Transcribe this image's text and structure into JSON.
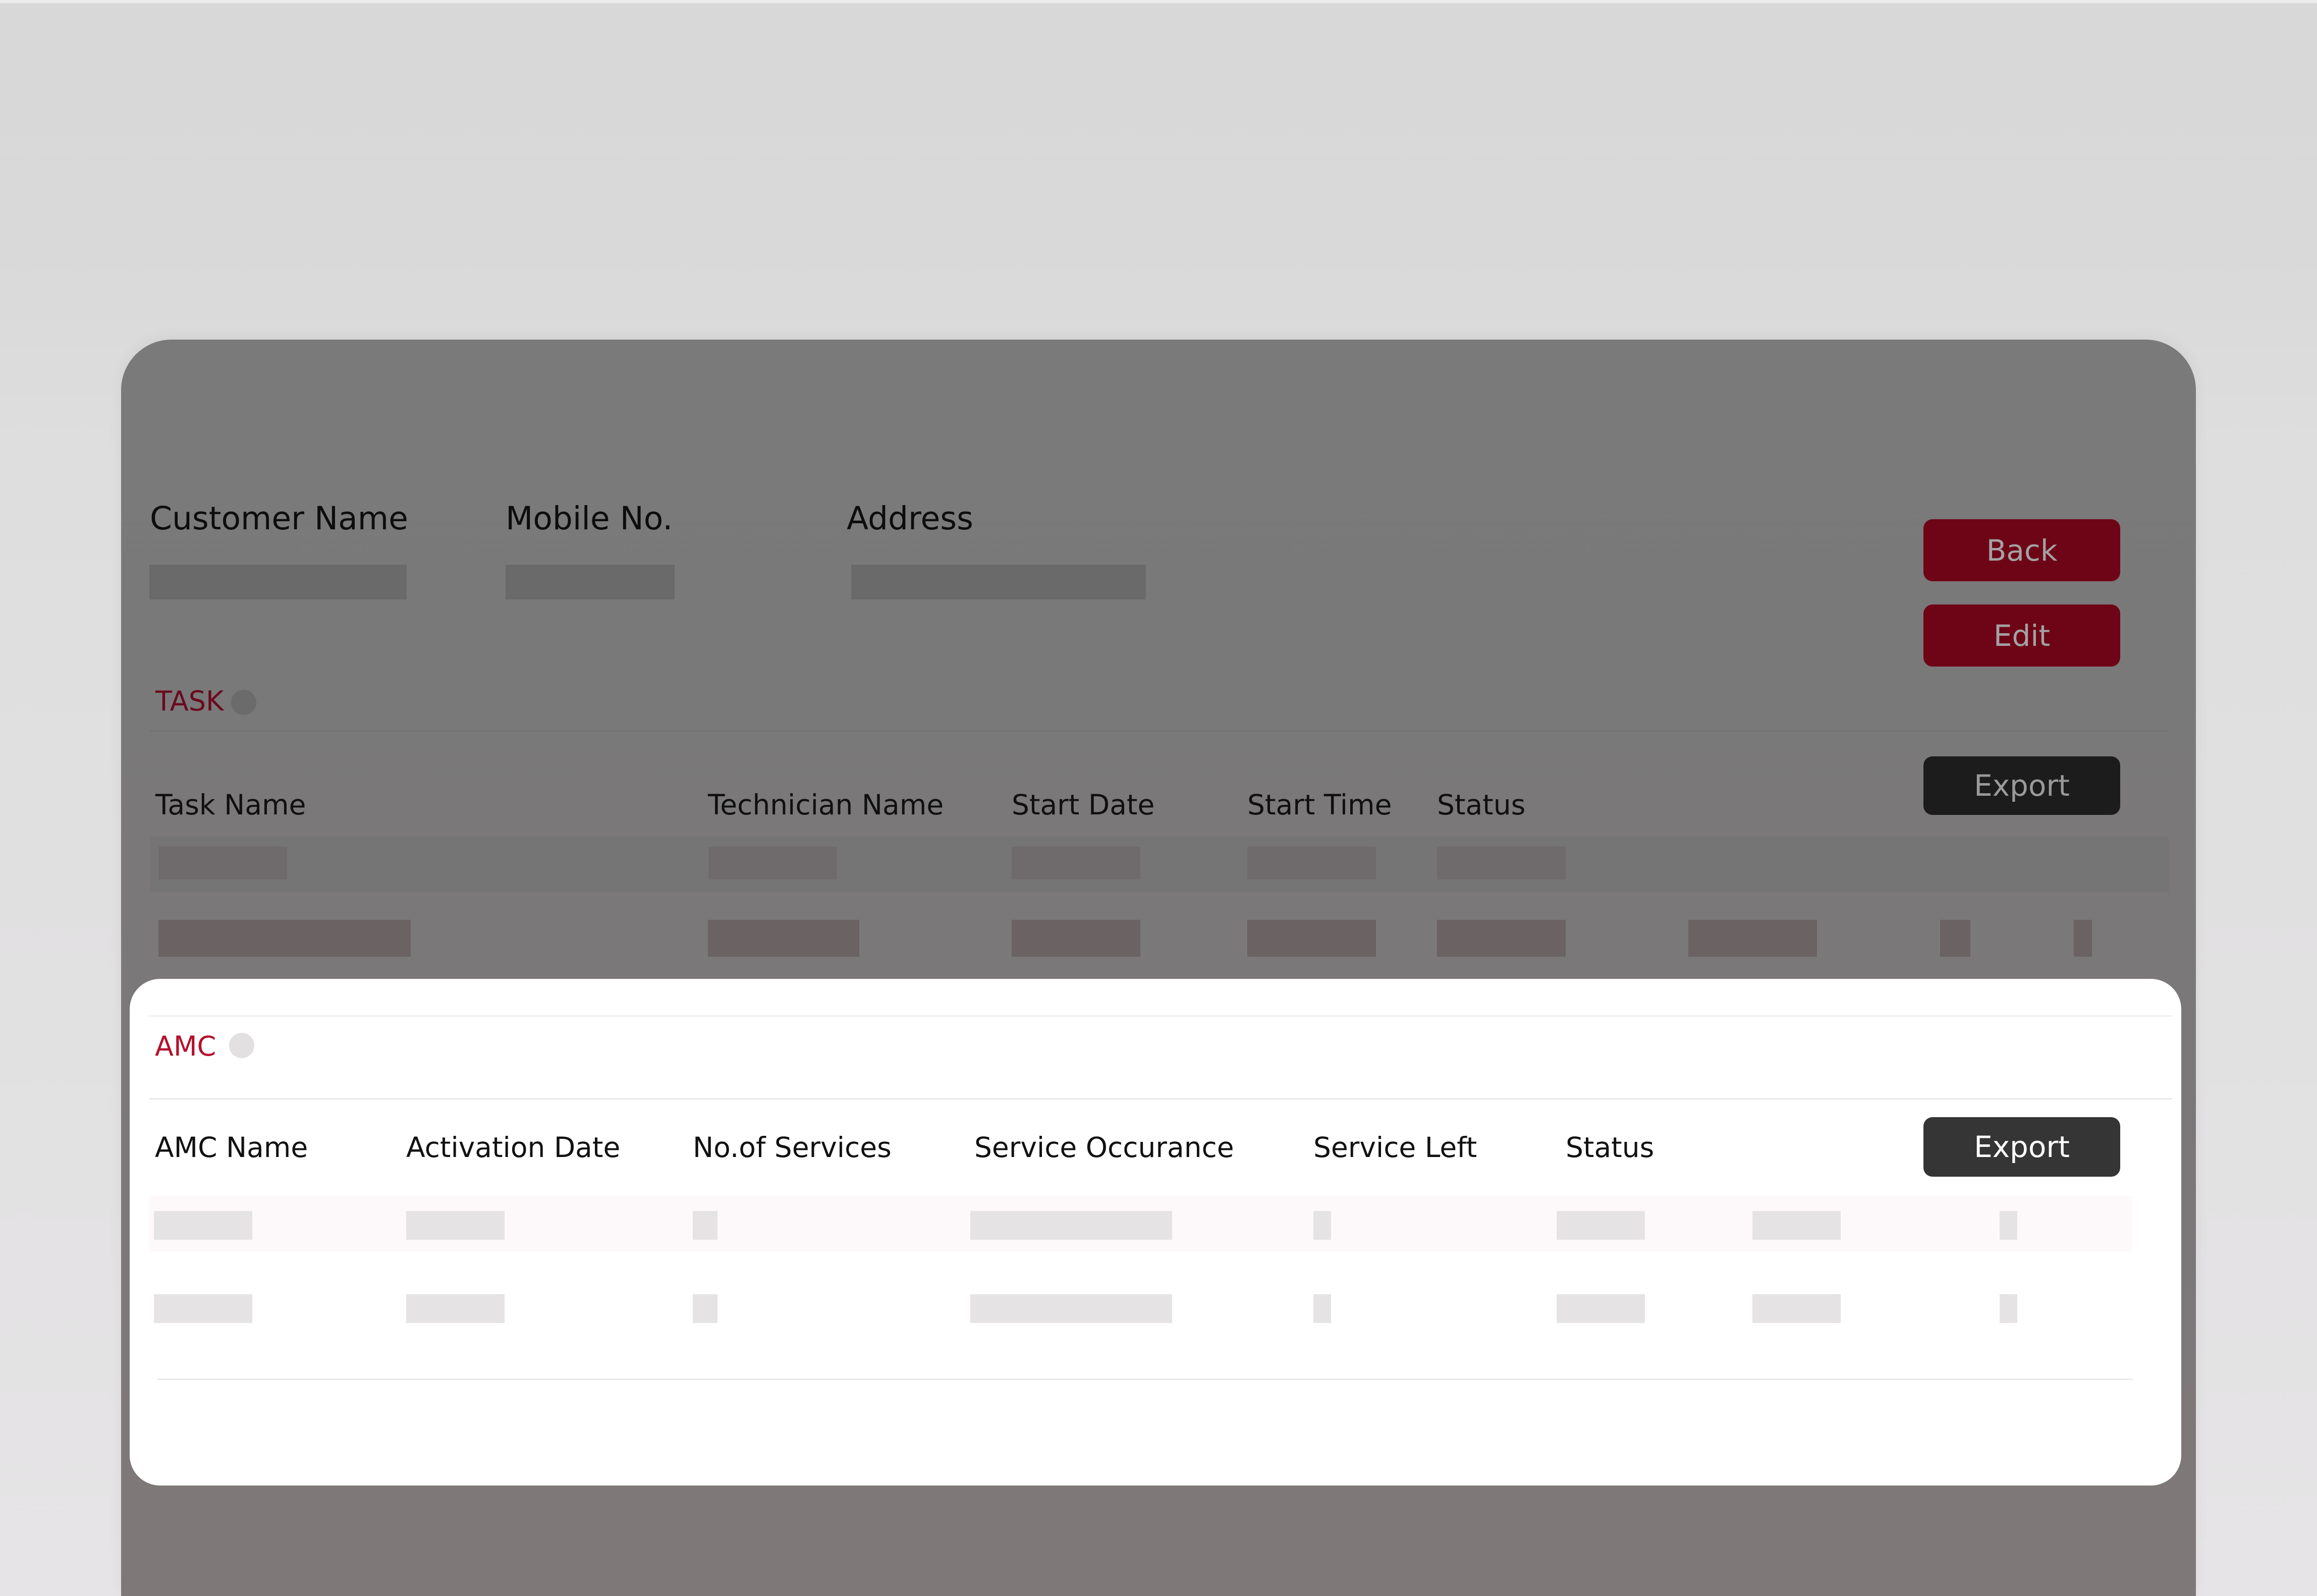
{
  "customer": {
    "name_label": "Customer Name",
    "mobile_label": "Mobile No.",
    "address_label": "Address"
  },
  "actions": {
    "back_label": "Back",
    "edit_label": "Edit"
  },
  "task_section": {
    "title": "TASK",
    "export_label": "Export",
    "columns": [
      "Task Name",
      "Technician Name",
      "Start Date",
      "Start Time",
      "Status"
    ]
  },
  "amc_section": {
    "title": "AMC",
    "export_label": "Export",
    "columns": [
      "AMC Name",
      "Activation Date",
      "No.of Services",
      "Service Occurance",
      "Service Left",
      "Status"
    ]
  },
  "colors": {
    "accent_red": "#b3102c",
    "button_red": "#6e0516",
    "button_dark": "#353535"
  },
  "icons": {
    "collapse": "chevron-down-icon",
    "status_dot": "dot-icon"
  }
}
